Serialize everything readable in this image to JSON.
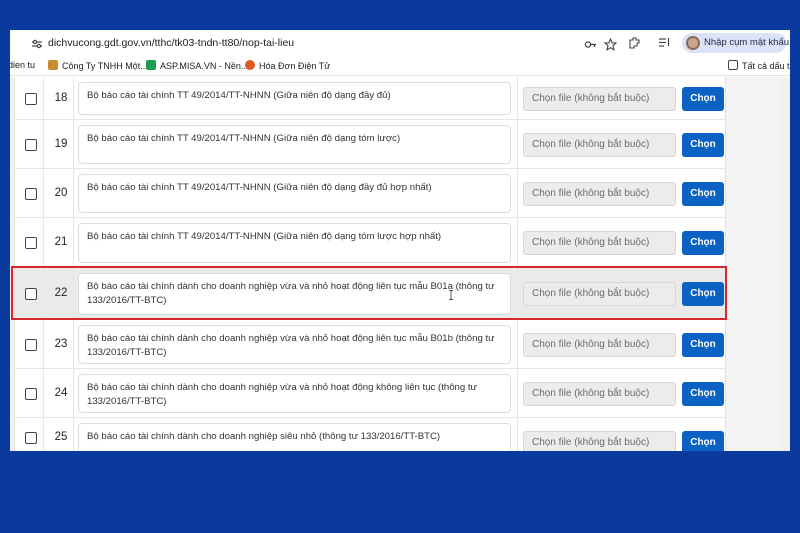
{
  "browser": {
    "url": "dichvucong.gdt.gov.vn/tthc/tk03-tndn-tt80/nop-tai-lieu",
    "profile_label": "Nhập cụm mật khẩu",
    "bookmarks": [
      {
        "label": "dien tu"
      },
      {
        "label": "Công Ty TNHH Một..."
      },
      {
        "label": "ASP.MISA.VN - Nền..."
      },
      {
        "label": "Hóa Đơn Điện Tử"
      }
    ],
    "all_bookmarks_label": "Tất cả dấu tr"
  },
  "file_placeholder": "Chọn file (không bắt buộc)",
  "choose_label": "Chọn",
  "rows": [
    {
      "number": "18",
      "description": "Bộ báo cáo tài chính TT 49/2014/TT-NHNN (Giữa niên độ dạng đầy đủ)"
    },
    {
      "number": "19",
      "description": "Bộ báo cáo tài chính TT 49/2014/TT-NHNN (Giữa niên độ dạng tóm lược)"
    },
    {
      "number": "20",
      "description": "Bộ báo cáo tài chính TT 49/2014/TT-NHNN (Giữa niên độ dạng đầy đủ hợp nhất)"
    },
    {
      "number": "21",
      "description": "Bộ báo cáo tài chính TT 49/2014/TT-NHNN (Giữa niên độ dạng tóm lược hợp nhất)"
    },
    {
      "number": "22",
      "description": "Bộ báo cáo tài chính dành cho doanh nghiệp vừa và nhỏ hoạt động liên tục mẫu B01a (thông tư 133/2016/TT-BTC)",
      "highlighted": true
    },
    {
      "number": "23",
      "description": "Bộ báo cáo tài chính dành cho doanh nghiệp vừa và nhỏ hoạt động liên tục mẫu B01b (thông tư 133/2016/TT-BTC)"
    },
    {
      "number": "24",
      "description": "Bộ báo cáo tài chính dành cho doanh nghiệp vừa và nhỏ hoạt động không liên tục (thông tư 133/2016/TT-BTC)"
    },
    {
      "number": "25",
      "description": "Bộ báo cáo tài chính dành cho doanh nghiệp siêu nhỏ (thông tư 133/2016/TT-BTC)"
    }
  ],
  "colors": {
    "background": "#0b3a9e",
    "primary_button": "#0a62c2",
    "highlight_border": "#d9262b"
  }
}
